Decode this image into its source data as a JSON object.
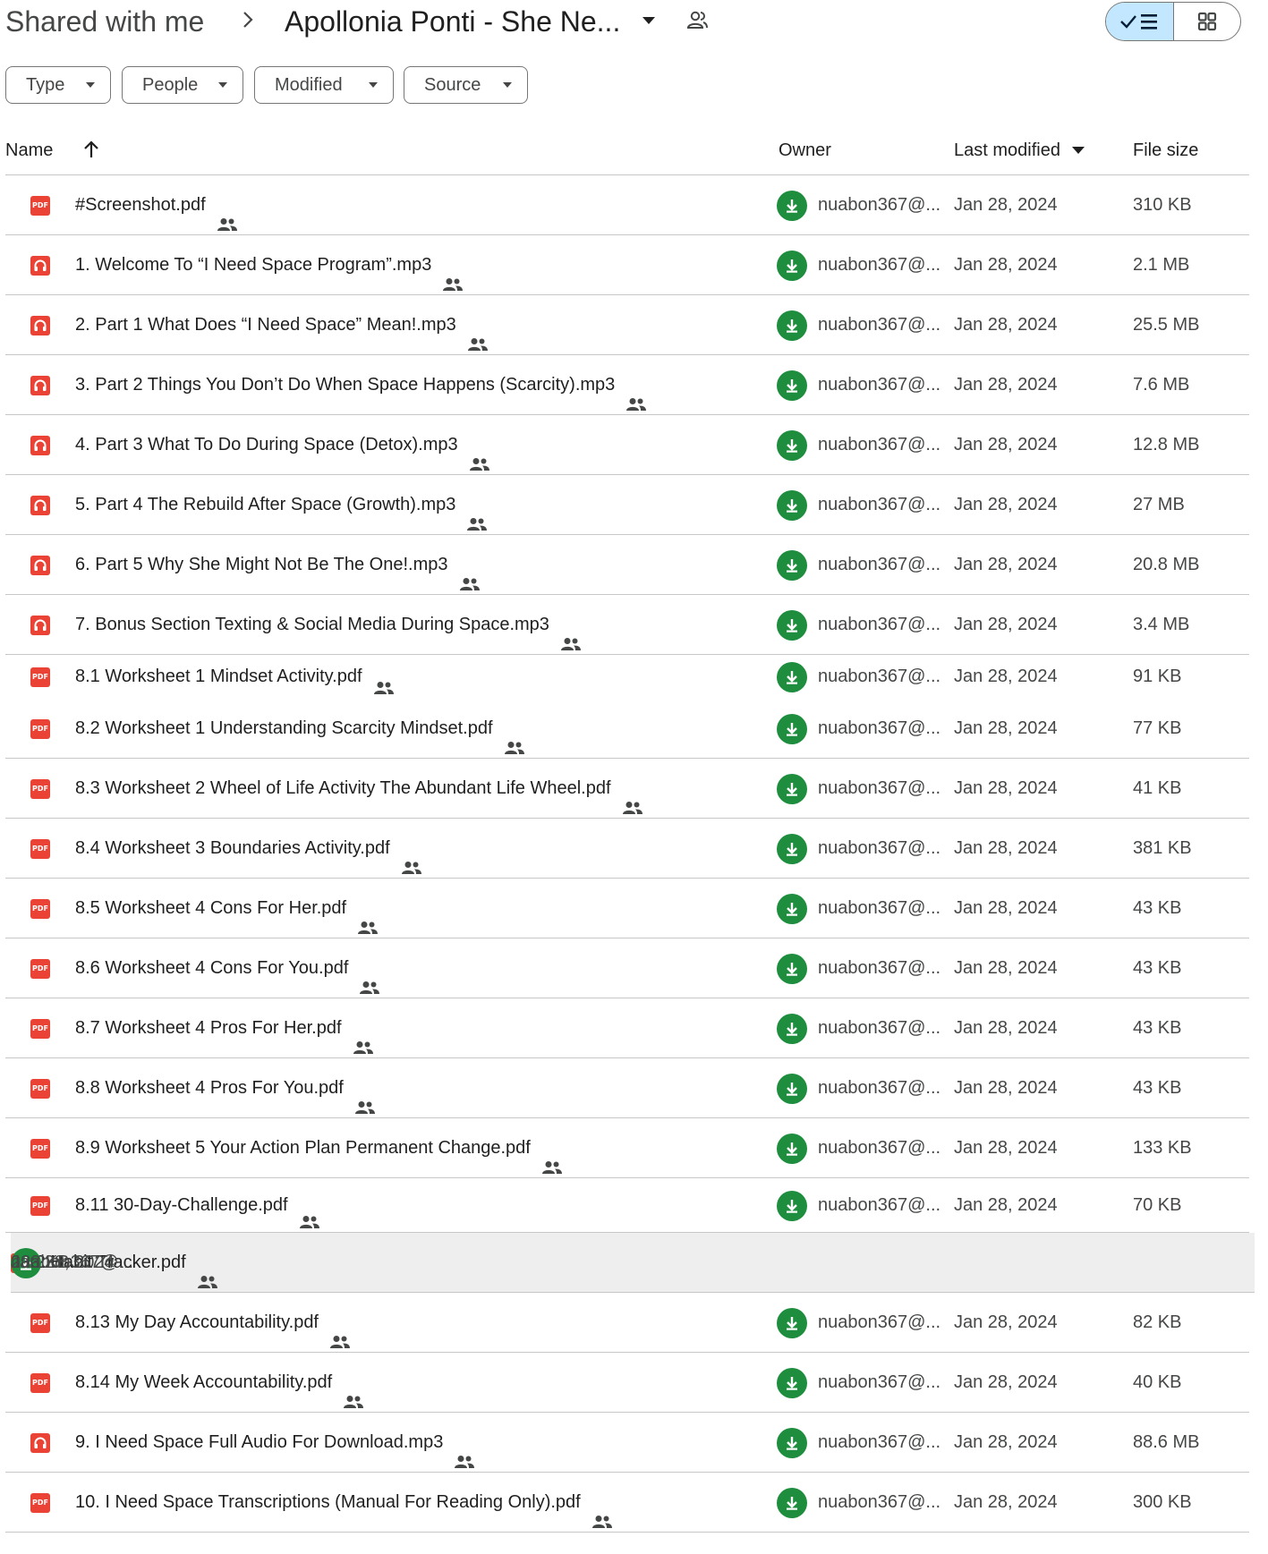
{
  "breadcrumb": {
    "root": "Shared with me",
    "current": "Apollonia Ponti - She Ne..."
  },
  "filters": [
    "Type",
    "People",
    "Modified",
    "Source"
  ],
  "columns": {
    "name": "Name",
    "owner": "Owner",
    "last_modified": "Last modified",
    "file_size": "File size"
  },
  "colors": {
    "accent": "#c2e7ff",
    "pdf_red": "#ea4335",
    "owner_green": "#1e8e3e",
    "selected_row": "#eeeeee"
  },
  "files": [
    {
      "type": "pdf",
      "name": "#Screenshot.pdf",
      "owner": "nuabon367@...",
      "modified": "Jan 28, 2024",
      "size": "310 KB"
    },
    {
      "type": "audio",
      "name": "1. Welcome To “I Need Space Program”.mp3",
      "owner": "nuabon367@...",
      "modified": "Jan 28, 2024",
      "size": "2.1 MB"
    },
    {
      "type": "audio",
      "name": "2. Part 1 What Does “I Need Space” Mean!.mp3",
      "owner": "nuabon367@...",
      "modified": "Jan 28, 2024",
      "size": "25.5 MB"
    },
    {
      "type": "audio",
      "name": "3. Part 2 Things You Don’t Do When Space Happens (Scarcity).mp3",
      "owner": "nuabon367@...",
      "modified": "Jan 28, 2024",
      "size": "7.6 MB"
    },
    {
      "type": "audio",
      "name": "4. Part 3 What To Do During Space (Detox).mp3",
      "owner": "nuabon367@...",
      "modified": "Jan 28, 2024",
      "size": "12.8 MB"
    },
    {
      "type": "audio",
      "name": "5. Part 4 The Rebuild After Space (Growth).mp3",
      "owner": "nuabon367@...",
      "modified": "Jan 28, 2024",
      "size": "27 MB"
    },
    {
      "type": "audio",
      "name": "6. Part 5 Why She Might Not Be The One!.mp3",
      "owner": "nuabon367@...",
      "modified": "Jan 28, 2024",
      "size": "20.8 MB"
    },
    {
      "type": "audio",
      "name": "7. Bonus Section Texting & Social Media During Space.mp3",
      "owner": "nuabon367@...",
      "modified": "Jan 28, 2024",
      "size": "3.4 MB"
    },
    {
      "type": "pdf",
      "name": "8.1 Worksheet 1 Mindset Activity.pdf",
      "owner": "nuabon367@...",
      "modified": "Jan 28, 2024",
      "size": "91 KB"
    },
    {
      "type": "pdf",
      "name": "8.2 Worksheet 1 Understanding Scarcity Mindset.pdf",
      "owner": "nuabon367@...",
      "modified": "Jan 28, 2024",
      "size": "77 KB"
    },
    {
      "type": "pdf",
      "name": "8.3 Worksheet 2 Wheel of Life Activity The Abundant Life Wheel.pdf",
      "owner": "nuabon367@...",
      "modified": "Jan 28, 2024",
      "size": "41 KB"
    },
    {
      "type": "pdf",
      "name": "8.4 Worksheet 3 Boundaries Activity.pdf",
      "owner": "nuabon367@...",
      "modified": "Jan 28, 2024",
      "size": "381 KB"
    },
    {
      "type": "pdf",
      "name": "8.5 Worksheet 4 Cons For Her.pdf",
      "owner": "nuabon367@...",
      "modified": "Jan 28, 2024",
      "size": "43 KB"
    },
    {
      "type": "pdf",
      "name": "8.6 Worksheet 4 Cons For You.pdf",
      "owner": "nuabon367@...",
      "modified": "Jan 28, 2024",
      "size": "43 KB"
    },
    {
      "type": "pdf",
      "name": "8.7 Worksheet 4 Pros For Her.pdf",
      "owner": "nuabon367@...",
      "modified": "Jan 28, 2024",
      "size": "43 KB"
    },
    {
      "type": "pdf",
      "name": "8.8 Worksheet 4 Pros For You.pdf",
      "owner": "nuabon367@...",
      "modified": "Jan 28, 2024",
      "size": "43 KB"
    },
    {
      "type": "pdf",
      "name": "8.9 Worksheet 5 Your Action Plan Permanent Change.pdf",
      "owner": "nuabon367@...",
      "modified": "Jan 28, 2024",
      "size": "133 KB"
    },
    {
      "type": "pdf",
      "name": "8.11 30-Day-Challenge.pdf",
      "owner": "nuabon367@...",
      "modified": "Jan 28, 2024",
      "size": "70 KB"
    },
    {
      "type": "pdf",
      "name": "8.12 Habit Tracker.pdf",
      "owner": "nuabon367@...",
      "modified": "Jan 28, 2024",
      "size": "233 KB",
      "selected": true
    },
    {
      "type": "pdf",
      "name": "8.13 My Day Accountability.pdf",
      "owner": "nuabon367@...",
      "modified": "Jan 28, 2024",
      "size": "82 KB"
    },
    {
      "type": "pdf",
      "name": "8.14 My Week Accountability.pdf",
      "owner": "nuabon367@...",
      "modified": "Jan 28, 2024",
      "size": "40 KB"
    },
    {
      "type": "audio",
      "name": "9. I Need Space Full Audio For Download.mp3",
      "owner": "nuabon367@...",
      "modified": "Jan 28, 2024",
      "size": "88.6 MB"
    },
    {
      "type": "pdf",
      "name": "10. I Need Space Transcriptions (Manual For Reading Only).pdf",
      "owner": "nuabon367@...",
      "modified": "Jan 28, 2024",
      "size": "300 KB"
    }
  ]
}
